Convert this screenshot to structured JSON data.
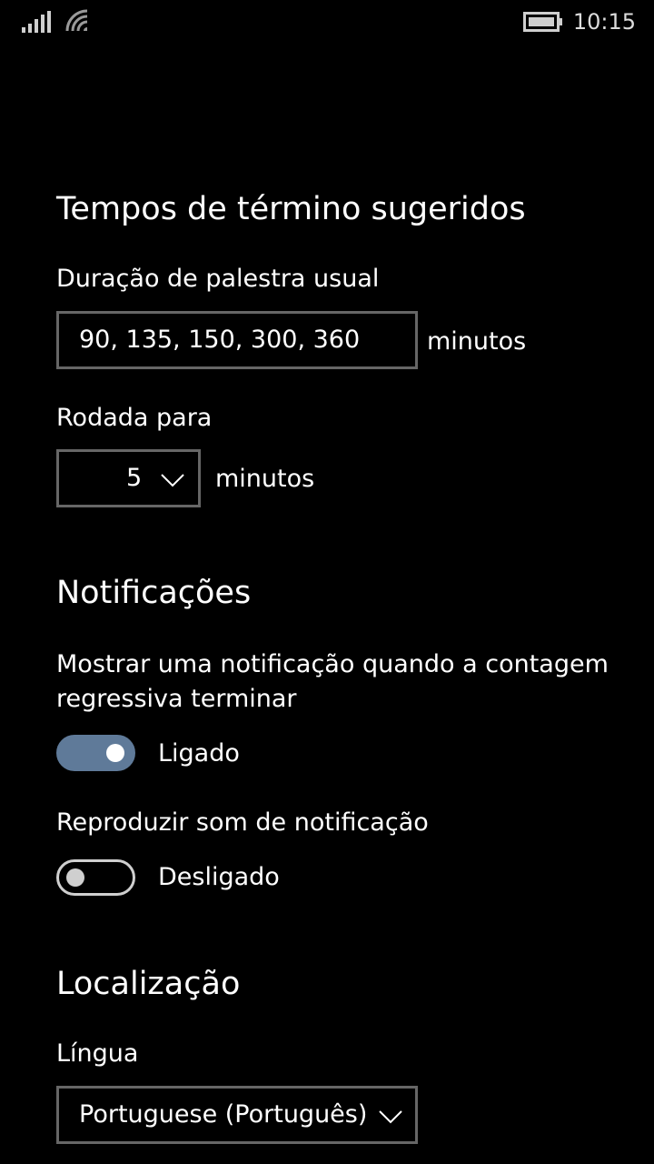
{
  "status_bar": {
    "time": "10:15",
    "signal_icon": "signal-bars-icon",
    "wifi_icon": "wifi-icon",
    "battery_icon": "battery-icon"
  },
  "suggested_times": {
    "title": "Tempos de término sugeridos",
    "duration_label": "Duração de palestra usual",
    "duration_value": "90, 135, 150, 300, 360",
    "duration_unit": "minutos",
    "rounding_label": "Rodada para",
    "rounding_value": "5",
    "rounding_unit": "minutos"
  },
  "notifications": {
    "title": "Notificações",
    "show_notification_label": "Mostrar uma notificação quando a contagem regressiva terminar",
    "show_notification_on": true,
    "show_notification_state": "Ligado",
    "sound_label": "Reproduzir som de notificação",
    "sound_on": false,
    "sound_state": "Desligado"
  },
  "localization": {
    "title": "Localização",
    "language_label": "Língua",
    "language_value": "Portuguese (Português)"
  },
  "colors": {
    "background": "#000000",
    "toggle_on": "#5f7a99",
    "border": "#666666"
  }
}
